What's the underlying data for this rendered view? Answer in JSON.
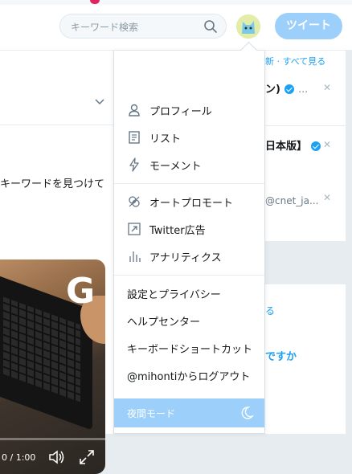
{
  "header": {
    "search_placeholder": "キーワード検索",
    "search_icon": "search-icon",
    "avatar": "avatar",
    "tweet_label": "ツイート"
  },
  "main": {
    "body_text": "キーワードを見つけて",
    "video": {
      "logo_letter": "G",
      "time": "0 / 1:00"
    }
  },
  "right": {
    "header_text": "新 · すべて見る",
    "suggestions": [
      {
        "name": "ン)",
        "handle": "…"
      },
      {
        "name": "日本版】",
        "handle": ""
      },
      {
        "name": "",
        "handle": "@cnet_ja..."
      }
    ],
    "link1": "る",
    "link2": "ですか"
  },
  "menu": {
    "items": [
      {
        "label": "プロフィール",
        "icon": "person-icon"
      },
      {
        "label": "リスト",
        "icon": "list-icon"
      },
      {
        "label": "モーメント",
        "icon": "lightning-icon"
      },
      {
        "label": "オートプロモート",
        "icon": "promote-icon"
      },
      {
        "label": "Twitter広告",
        "icon": "external-link-icon"
      },
      {
        "label": "アナリティクス",
        "icon": "analytics-icon"
      }
    ],
    "settings": [
      {
        "label": "設定とプライバシー"
      },
      {
        "label": "ヘルプセンター"
      },
      {
        "label": "キーボードショートカット"
      },
      {
        "label": "@mihontiからログアウト"
      }
    ],
    "night_mode": "夜間モード"
  },
  "colors": {
    "accent": "#1da1f2",
    "tweet_button": "#9ccffa",
    "background": "#e6ecf0"
  }
}
